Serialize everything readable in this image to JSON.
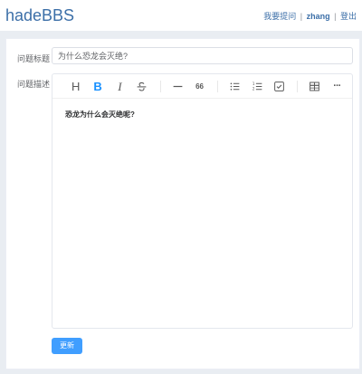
{
  "header": {
    "brand": "hadeBBS",
    "nav": {
      "ask": "我要提问",
      "sep1": "|",
      "username": "zhang",
      "sep2": "|",
      "logout": "登出"
    }
  },
  "form": {
    "title_label": "问题标题",
    "title_value": "为什么恐龙会灭绝?",
    "desc_label": "问题描述",
    "editor_content": "恐龙为什么会灭绝呢?",
    "submit_label": "更新"
  },
  "toolbar": {
    "heading_label": "H",
    "bold_label": "B",
    "italic_label": "I",
    "quote_label": "66",
    "more_label": "···",
    "icons": [
      "heading-icon",
      "bold-icon",
      "italic-icon",
      "strikethrough-icon",
      "horizontal-rule-icon",
      "quote-icon",
      "bullet-list-icon",
      "ordered-list-icon",
      "task-list-icon",
      "table-icon",
      "more-icon"
    ],
    "active_color": "#1890ff"
  },
  "colors": {
    "brand": "#3c6fa8",
    "primary_button": "#409eff"
  }
}
